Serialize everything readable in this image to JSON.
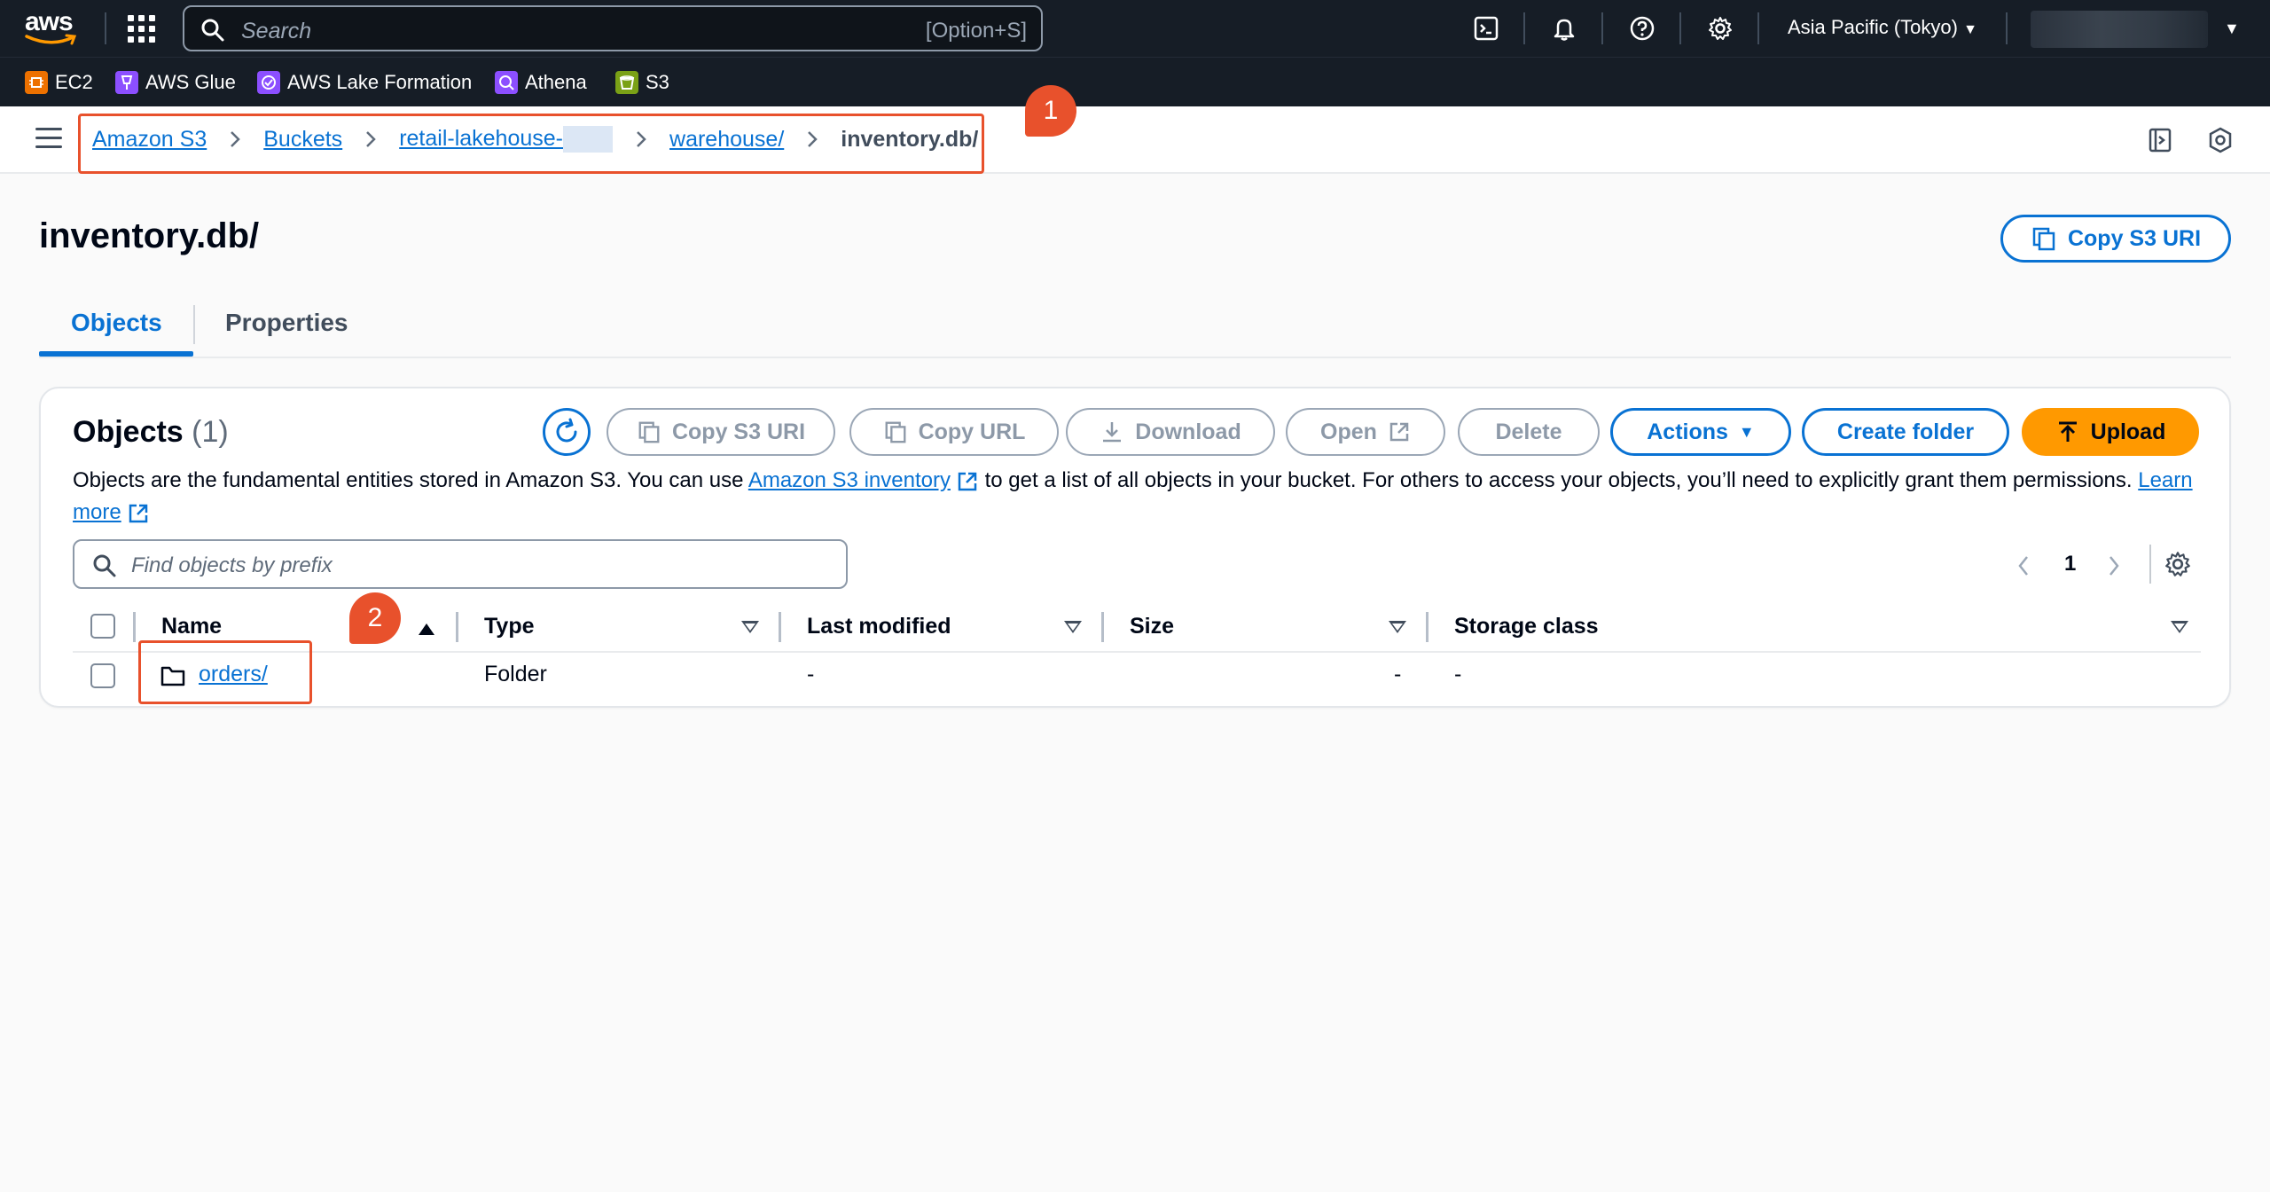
{
  "topnav": {
    "logo_text": "aws",
    "search_placeholder": "Search",
    "search_shortcut": "[Option+S]",
    "region": "Asia Pacific (Tokyo)"
  },
  "favorites": [
    {
      "label": "EC2",
      "color": "#ed7100"
    },
    {
      "label": "AWS Glue",
      "color": "#8c4fff"
    },
    {
      "label": "AWS Lake Formation",
      "color": "#8c4fff"
    },
    {
      "label": "Athena",
      "color": "#8c4fff"
    },
    {
      "label": "S3",
      "color": "#7aa116"
    }
  ],
  "breadcrumb": {
    "items": [
      "Amazon S3",
      "Buckets",
      "retail-lakehouse-",
      "warehouse/"
    ],
    "current": "inventory.db/"
  },
  "annotations": {
    "badge1": "1",
    "badge2": "2"
  },
  "page": {
    "title": "inventory.db/",
    "copy_uri_label": "Copy S3 URI"
  },
  "tabs": [
    {
      "label": "Objects",
      "active": true
    },
    {
      "label": "Properties",
      "active": false
    }
  ],
  "objects_panel": {
    "title": "Objects",
    "count": "(1)",
    "buttons": {
      "copy_s3_uri": "Copy S3 URI",
      "copy_url": "Copy URL",
      "download": "Download",
      "open": "Open",
      "delete": "Delete",
      "actions": "Actions",
      "create_folder": "Create folder",
      "upload": "Upload"
    },
    "description_1": "Objects are the fundamental entities stored in Amazon S3. You can use ",
    "description_link_1": "Amazon S3 inventory",
    "description_2": " to get a list of all objects in your bucket. For others to access your objects, you’ll need to explicitly grant them permissions. ",
    "description_link_2": "Learn more",
    "filter_placeholder": "Find objects by prefix",
    "page_number": "1",
    "columns": [
      "Name",
      "Type",
      "Last modified",
      "Size",
      "Storage class"
    ],
    "rows": [
      {
        "name": "orders/",
        "type": "Folder",
        "last_modified": "-",
        "size": "-",
        "storage_class": "-"
      }
    ]
  },
  "colors": {
    "accent": "#0972d3",
    "nav_bg": "#161d26",
    "upload": "#ff9900",
    "annotation": "#e8512c"
  }
}
